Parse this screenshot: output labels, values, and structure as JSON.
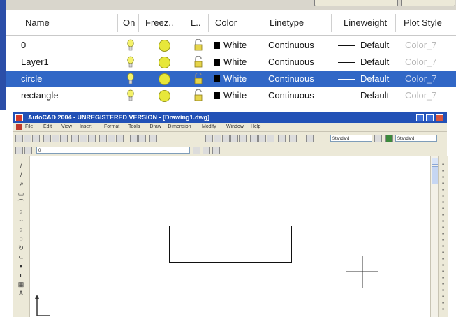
{
  "layer_manager": {
    "columns": {
      "name": "Name",
      "on": "On",
      "freeze": "Freez..",
      "lock": "L..",
      "color": "Color",
      "linetype": "Linetype",
      "lineweight": "Lineweight",
      "plot_style": "Plot Style"
    },
    "rows": [
      {
        "name": "0",
        "color": "White",
        "linetype": "Continuous",
        "lineweight": "Default",
        "plot_style": "Color_7",
        "selected": false
      },
      {
        "name": "Layer1",
        "color": "White",
        "linetype": "Continuous",
        "lineweight": "Default",
        "plot_style": "Color_7",
        "selected": false
      },
      {
        "name": "circle",
        "color": "White",
        "linetype": "Continuous",
        "lineweight": "Default",
        "plot_style": "Color_7",
        "selected": true
      },
      {
        "name": "rectangle",
        "color": "White",
        "linetype": "Continuous",
        "lineweight": "Default",
        "plot_style": "Color_7",
        "selected": false
      }
    ],
    "selection_color": "#3167c6"
  },
  "acad": {
    "title": "AutoCAD 2004 - UNREGISTERED VERSION - [Drawing1.dwg]",
    "menu": [
      "File",
      "Edit",
      "View",
      "Insert",
      "Format",
      "Tools",
      "Draw",
      "Dimension",
      "Modify",
      "Window",
      "Help"
    ],
    "toolbar": {
      "text_style_combo": "Standard",
      "dim_style_combo": "Standard",
      "layer_combo": "0"
    },
    "title_bar_color": "#2251b6"
  }
}
